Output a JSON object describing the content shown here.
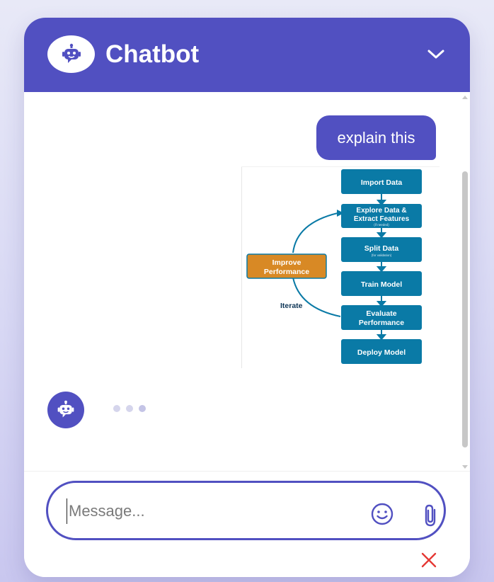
{
  "header": {
    "title": "Chatbot"
  },
  "messages": {
    "user_text": "explain this"
  },
  "diagram": {
    "nodes": {
      "import": "Import Data",
      "explore_1": "Explore Data &",
      "explore_2": "Extract Features",
      "explore_sub": "(if needed)",
      "split": "Split Data",
      "split_sub": "(for validation)",
      "train": "Train Model",
      "evaluate_1": "Evaluate",
      "evaluate_2": "Performance",
      "deploy": "Deploy Model",
      "improve_1": "Improve",
      "improve_2": "Performance"
    },
    "iterate_label": "Iterate"
  },
  "composer": {
    "placeholder": "Message..."
  },
  "colors": {
    "brand": "#5150c1",
    "flow_box": "#0a7aa6",
    "improve_box": "#d88925",
    "cancel": "#e53935"
  }
}
